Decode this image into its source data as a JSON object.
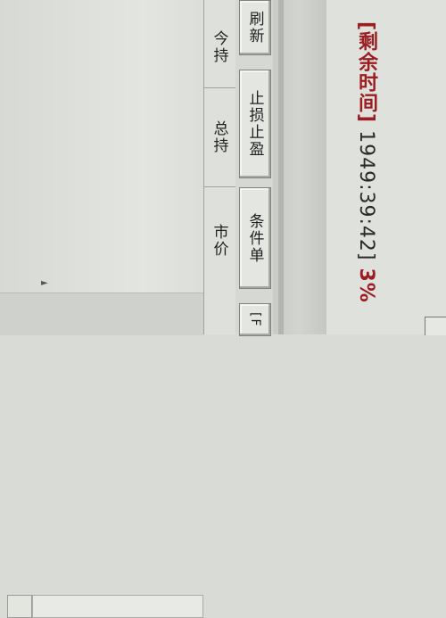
{
  "status": {
    "label": "[剩余时间]",
    "time": "1949:39:42]",
    "percent": "3%"
  },
  "buttons": {
    "refresh": "刷新",
    "stop_loss": "止损止盈",
    "condition_order": "条件单",
    "partial": "[F"
  },
  "columns": {
    "position_short": "今持",
    "position_total": "总持",
    "market_price": "市价"
  },
  "icons": {
    "scroll_arrow": "►"
  }
}
